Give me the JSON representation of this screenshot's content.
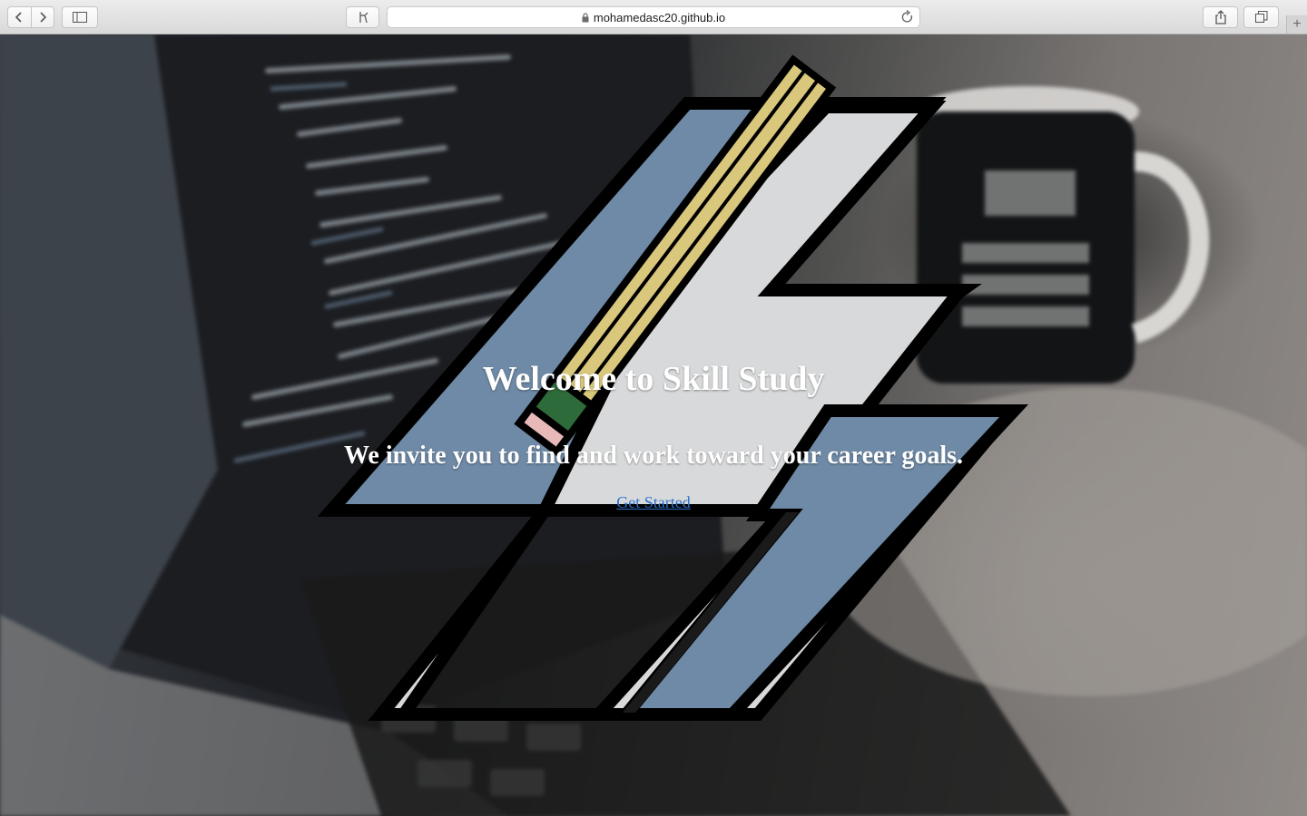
{
  "browser": {
    "url": "mohamedasc20.github.io",
    "icons": {
      "back": "chevron-left-icon",
      "forward": "chevron-right-icon",
      "sidebar": "sidebar-icon",
      "extension": "readability-icon",
      "lock": "lock-icon",
      "reload": "reload-icon",
      "share": "share-icon",
      "tabs": "tab-overview-icon",
      "new_tab": "plus-icon"
    },
    "new_tab_glyph": "+"
  },
  "hero": {
    "title": "Welcome to Skill Study",
    "subtitle": "We invite you to find and work toward your career goals.",
    "cta_label": "Get Started"
  },
  "colors": {
    "title_text": "#ffffff",
    "link": "#2f73c9",
    "logo_blue": "#6f8aa6",
    "logo_light": "#d8d9da",
    "pencil_yellow": "#d9c77c",
    "pencil_eraser_band": "#2e6b3a"
  }
}
